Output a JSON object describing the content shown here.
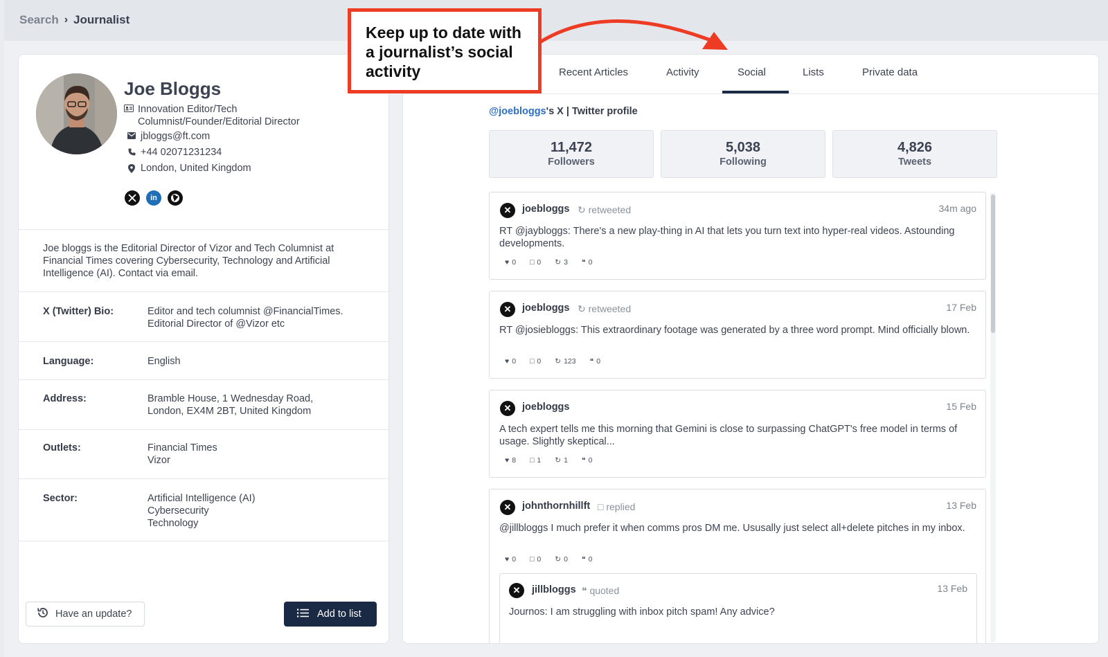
{
  "breadcrumb": {
    "parent": "Search",
    "current": "Journalist"
  },
  "callout": {
    "text": "Keep up to date with a journalist’s social activity"
  },
  "profile": {
    "name": "Joe Bloggs",
    "role": "Innovation Editor/Tech Columnist/Founder/Editorial Director",
    "email": "jbloggs@ft.com",
    "phone": "+44 02071231234",
    "location": "London, United Kingdom",
    "about": "Joe bloggs is the Editorial Director of Vizor and Tech Columnist at Financial Times covering Cybersecurity, Technology and Artificial Intelligence (AI). Contact via email.",
    "details": [
      {
        "label": "X (Twitter) Bio:",
        "value": "Editor and tech columnist @FinancialTimes.\nEditorial Director of @Vizor etc"
      },
      {
        "label": "Language:",
        "value": "English"
      },
      {
        "label": "Address:",
        "value": "Bramble House, 1 Wednesday Road,\nLondon, EX4M 2BT, United Kingdom"
      },
      {
        "label": "Outlets:",
        "value": "Financial Times\nVizor"
      },
      {
        "label": "Sector:",
        "value": "Artificial Intelligence (AI)\nCybersecurity\nTechnology"
      }
    ],
    "buttons": {
      "update": "Have an update?",
      "add": "Add to list"
    }
  },
  "tabs": [
    "Recent Articles",
    "Activity",
    "Social",
    "Lists",
    "Private data"
  ],
  "active_tab": "Social",
  "social": {
    "handle": "@joebloggs",
    "profile_suffix": "'s X | Twitter profile",
    "stats": [
      {
        "value": "11,472",
        "label": "Followers"
      },
      {
        "value": "5,038",
        "label": "Following"
      },
      {
        "value": "4,826",
        "label": "Tweets"
      }
    ],
    "tweets": [
      {
        "user": "joebloggs",
        "action": "retweeted",
        "time": "34m ago",
        "text": "RT @jaybloggs: There's a new play-thing in AI that lets you turn text into hyper-real videos. Astounding developments.",
        "likes": "0",
        "replies": "0",
        "retweets": "3",
        "quotes": "0"
      },
      {
        "user": "joebloggs",
        "action": "retweeted",
        "time": "17 Feb",
        "text": "RT @josiebloggs: This extraordinary footage was generated by a three word prompt. Mind officially blown.",
        "likes": "0",
        "replies": "0",
        "retweets": "123",
        "quotes": "0"
      },
      {
        "user": "joebloggs",
        "action": "",
        "time": "15 Feb",
        "text": "A tech expert tells me this morning that Gemini is close to surpassing ChatGPT's free model in terms of usage. Slightly skeptical...",
        "likes": "8",
        "replies": "1",
        "retweets": "1",
        "quotes": "0"
      },
      {
        "user": "johnthornhillft",
        "action": "replied",
        "time": "13 Feb",
        "text": "@jillbloggs I much prefer it when comms pros DM me. Ususally just select all+delete pitches in my inbox.",
        "likes": "0",
        "replies": "0",
        "retweets": "0",
        "quotes": "0"
      }
    ],
    "quoted": {
      "user": "jillbloggs",
      "action": "quoted",
      "time": "13 Feb",
      "text": "Journos: I am struggling with inbox pitch spam! Any advice?"
    }
  },
  "colors": {
    "accent_navy": "#1b2a44",
    "callout_red": "#ee3b24",
    "link_blue": "#2f6ec5"
  }
}
